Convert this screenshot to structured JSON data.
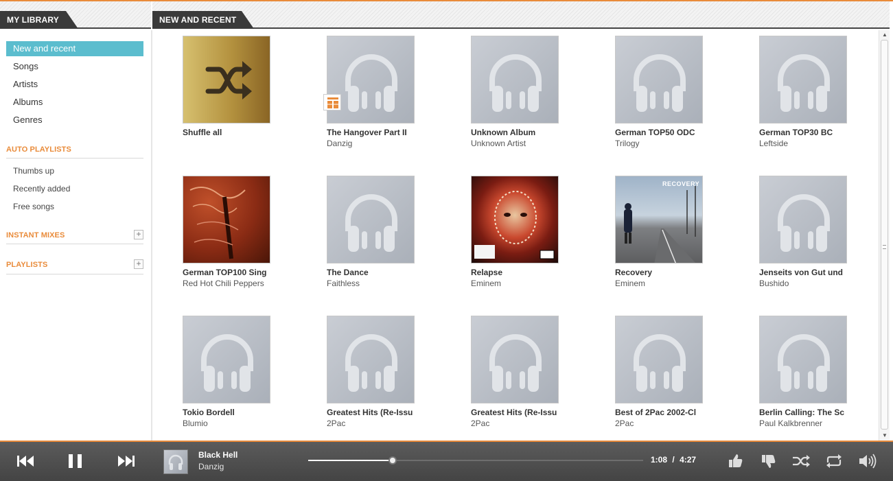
{
  "library": {
    "tab_label": "MY LIBRARY",
    "nav": [
      {
        "label": "New and recent",
        "active": true
      },
      {
        "label": "Songs"
      },
      {
        "label": "Artists"
      },
      {
        "label": "Albums"
      },
      {
        "label": "Genres"
      }
    ]
  },
  "auto_playlists": {
    "title": "AUTO PLAYLISTS",
    "items": [
      "Thumbs up",
      "Recently added",
      "Free songs"
    ]
  },
  "instant_mixes": {
    "title": "INSTANT MIXES",
    "add_label": "+"
  },
  "playlists": {
    "title": "PLAYLISTS",
    "add_label": "+"
  },
  "main": {
    "tab_label": "NEW AND RECENT",
    "albums": [
      {
        "title": "Shuffle all",
        "artist": "",
        "art": "shuffle-art"
      },
      {
        "title": "The Hangover Part II",
        "artist": "Danzig",
        "art": "headphones-placeholder-art"
      },
      {
        "title": "Unknown Album",
        "artist": "Unknown Artist",
        "art": "headphones-placeholder-art"
      },
      {
        "title": "German TOP50 ODC",
        "artist": "Trilogy",
        "art": "headphones-placeholder-art"
      },
      {
        "title": "German TOP30 BC",
        "artist": "Leftside",
        "art": "headphones-placeholder-art"
      },
      {
        "title": "German TOP100 Sing",
        "artist": "Red Hot Chili Peppers",
        "art": "red-graffiti-art"
      },
      {
        "title": "The Dance",
        "artist": "Faithless",
        "art": "headphones-placeholder-art"
      },
      {
        "title": "Relapse",
        "artist": "Eminem",
        "art": "pill-mosaic-face-art"
      },
      {
        "title": "Recovery",
        "artist": "Eminem",
        "art": "road-man-art",
        "art_text": "RECOVERY"
      },
      {
        "title": "Jenseits von Gut und",
        "artist": "Bushido",
        "art": "headphones-placeholder-art"
      },
      {
        "title": "Tokio Bordell",
        "artist": "Blumio",
        "art": "headphones-placeholder-art"
      },
      {
        "title": "Greatest Hits (Re-Issu",
        "artist": "2Pac",
        "art": "headphones-placeholder-art"
      },
      {
        "title": "Greatest Hits (Re-Issu",
        "artist": "2Pac",
        "art": "headphones-placeholder-art"
      },
      {
        "title": "Best of 2Pac 2002-Cl",
        "artist": "2Pac",
        "art": "headphones-placeholder-art"
      },
      {
        "title": "Berlin Calling: The Sc",
        "artist": "Paul Kalkbrenner",
        "art": "headphones-placeholder-art"
      }
    ]
  },
  "player": {
    "track_title": "Black Hell",
    "track_artist": "Danzig",
    "elapsed": "1:08",
    "separator": "/",
    "duration": "4:27",
    "progress_fraction": 0.2547,
    "icons": [
      "previous-icon",
      "pause-icon",
      "next-icon",
      "thumbs-up-icon",
      "thumbs-down-icon",
      "shuffle-icon",
      "repeat-icon",
      "volume-icon"
    ]
  },
  "colors": {
    "accent_orange": "#e98b3a",
    "active_nav": "#5bbdce",
    "dark_tab": "#3a3a3a",
    "player_bg": "#4e4e4e"
  }
}
